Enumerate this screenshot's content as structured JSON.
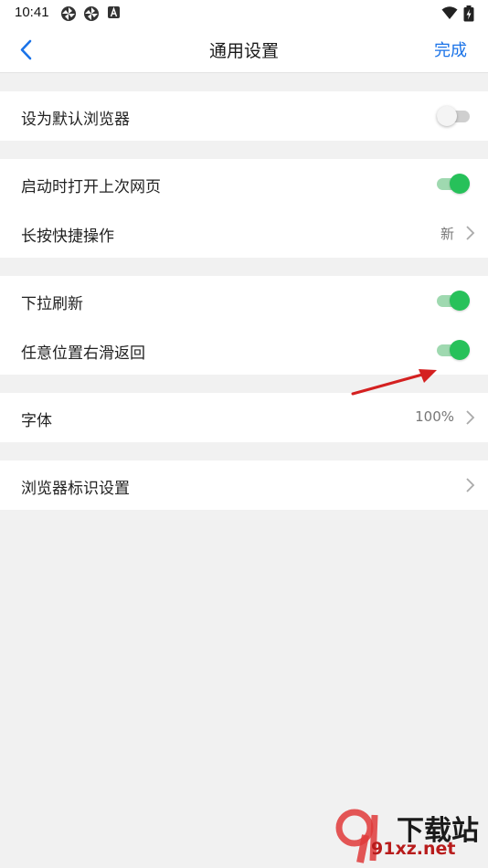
{
  "status_bar": {
    "time": "10:41",
    "icons": [
      "pinwheel-icon",
      "pinwheel-icon",
      "a-box-icon",
      "wifi-icon",
      "battery-icon"
    ]
  },
  "header": {
    "title": "通用设置",
    "done_label": "完成",
    "back_icon": "chevron-left-icon"
  },
  "settings": {
    "default_browser": {
      "label": "设为默认浏览器",
      "enabled": false
    },
    "restore_last_pages": {
      "label": "启动时打开上次网页",
      "enabled": true
    },
    "long_press": {
      "label": "长按快捷操作",
      "value": "新"
    },
    "pull_to_refresh": {
      "label": "下拉刷新",
      "enabled": true
    },
    "swipe_back": {
      "label": "任意位置右滑返回",
      "enabled": true
    },
    "font": {
      "label": "字体",
      "value": "100%"
    },
    "ua_settings": {
      "label": "浏览器标识设置"
    }
  },
  "watermark": {
    "main": "下载站",
    "sub": "91xz.net"
  },
  "colors": {
    "accent": "#1a73e8",
    "toggle_on": "#27c15a",
    "toggle_off": "#cfcfcf",
    "background": "#f1f1f1",
    "annotation_arrow": "#d42020"
  }
}
